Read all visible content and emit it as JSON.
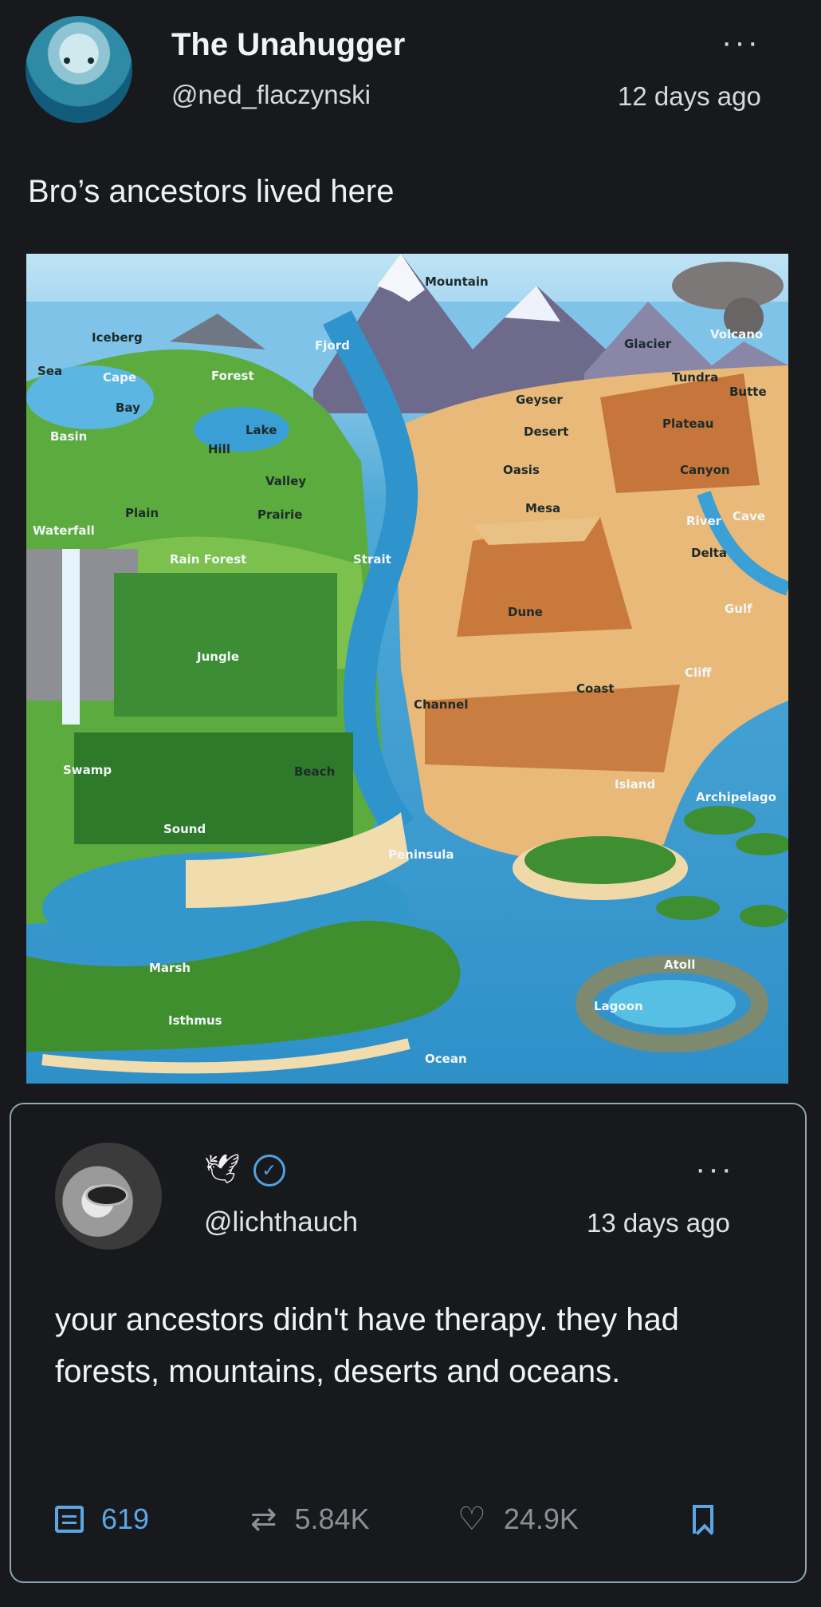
{
  "post": {
    "display_name": "The Unahugger",
    "handle": "@ned_flaczynski",
    "time": "12 days ago",
    "text": "Bro’s ancestors lived here",
    "more": "···"
  },
  "map_labels": [
    "Mountain",
    "Volcano",
    "Glacier",
    "Iceberg",
    "Sea",
    "Cape",
    "Forest",
    "Fjord",
    "Tundra",
    "Butte",
    "Bay",
    "Geyser",
    "Plateau",
    "Basin",
    "Lake",
    "Desert",
    "Hill",
    "Oasis",
    "Canyon",
    "Valley",
    "Plain",
    "Prairie",
    "Mesa",
    "River",
    "Cave",
    "Waterfall",
    "Rain Forest",
    "Strait",
    "Delta",
    "Dune",
    "Gulf",
    "Jungle",
    "Cliff",
    "Coast",
    "Channel",
    "Swamp",
    "Beach",
    "Island",
    "Archipelago",
    "Sound",
    "Peninsula",
    "Atoll",
    "Marsh",
    "Lagoon",
    "Isthmus",
    "Ocean"
  ],
  "quote": {
    "badge_icon": "dove-icon",
    "verified_icon": "verified-icon",
    "handle": "@lichthauch",
    "time": "13 days ago",
    "text": "your ancestors didn't have therapy. they had forests, mountains, deserts and oceans.",
    "more": "···",
    "comments": "619",
    "reposts": "5.84K",
    "likes": "24.9K"
  },
  "colors": {
    "background": "#18191c",
    "accent": "#5aa7e6",
    "muted": "#8b9096",
    "card_border": "#8ea7b3"
  }
}
